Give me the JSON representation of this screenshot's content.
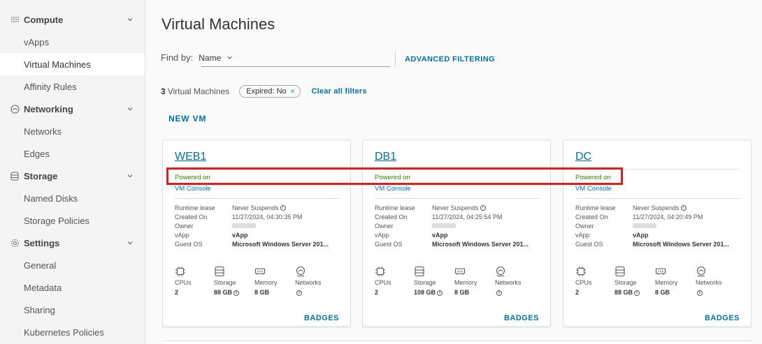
{
  "sidebar": {
    "groups": [
      {
        "label": "Compute",
        "icon": "grid-icon",
        "items": [
          "vApps",
          "Virtual Machines",
          "Affinity Rules"
        ]
      },
      {
        "label": "Networking",
        "icon": "network-icon",
        "items": [
          "Networks",
          "Edges"
        ]
      },
      {
        "label": "Storage",
        "icon": "storage-icon",
        "items": [
          "Named Disks",
          "Storage Policies"
        ]
      },
      {
        "label": "Settings",
        "icon": "gear-icon",
        "items": [
          "General",
          "Metadata",
          "Sharing",
          "Kubernetes Policies"
        ]
      }
    ],
    "active": "Virtual Machines"
  },
  "page": {
    "title": "Virtual Machines",
    "find_by_label": "Find by:",
    "find_by_value": "Name",
    "advanced_filtering": "ADVANCED FILTERING",
    "count_number": "3",
    "count_label": "Virtual Machines",
    "filter_chip": "Expired: No",
    "filter_chip_remove": "×",
    "clear_filters": "Clear all filters",
    "new_vm": "NEW VM"
  },
  "card_labels": {
    "runtime_lease": "Runtime lease",
    "created_on": "Created On",
    "owner": "Owner",
    "vapp": "vApp",
    "guest_os": "Guest OS",
    "cpus": "CPUs",
    "storage": "Storage",
    "memory": "Memory",
    "networks": "Networks",
    "badges": "BADGES",
    "console": "VM Console"
  },
  "vms": [
    {
      "name": "WEB1",
      "status": "Powered on",
      "runtime_lease": "Never Suspends",
      "created_on": "11/27/2024, 04:30:35 PM",
      "vapp": "vApp",
      "guest_os": "Microsoft Windows Server 201...",
      "cpus": "2",
      "storage": "88 GB",
      "memory": "8 GB"
    },
    {
      "name": "DB1",
      "status": "Powered on",
      "runtime_lease": "Never Suspends",
      "created_on": "11/27/2024, 04:25:54 PM",
      "vapp": "vApp",
      "guest_os": "Microsoft Windows Server 201...",
      "cpus": "2",
      "storage": "108 GB",
      "memory": "8 GB"
    },
    {
      "name": "DC",
      "status": "Powered on",
      "runtime_lease": "Never Suspends",
      "created_on": "11/27/2024, 04:20:49 PM",
      "vapp": "vApp",
      "guest_os": "Microsoft Windows Server 201...",
      "cpus": "2",
      "storage": "88 GB",
      "memory": "8 GB"
    }
  ],
  "colors": {
    "link": "#0072a3",
    "powered_on": "#318700",
    "highlight": "#e31b1b"
  }
}
